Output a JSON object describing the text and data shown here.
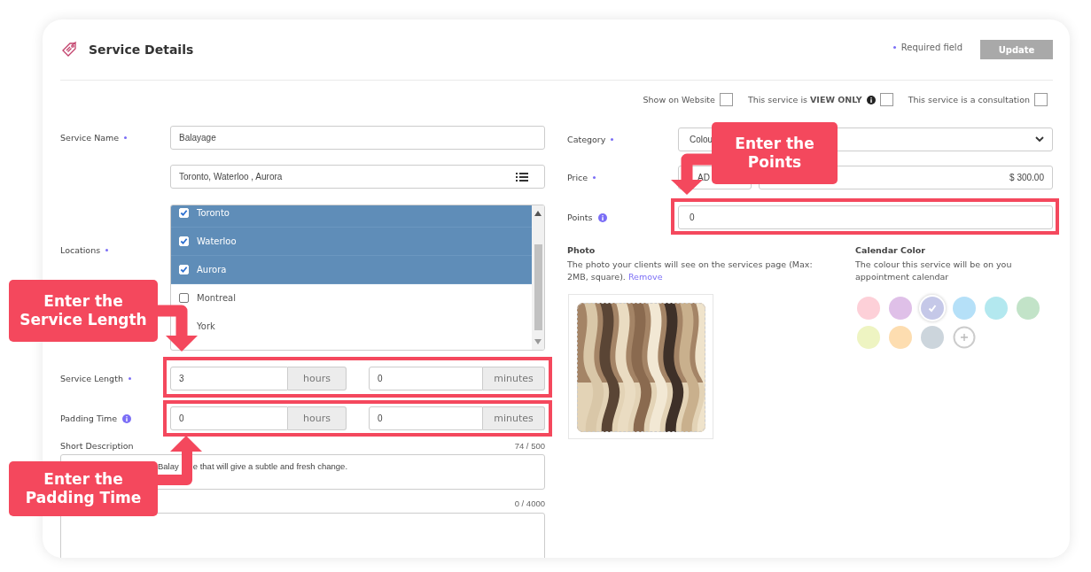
{
  "header": {
    "title": "Service Details",
    "required_note": "Required field",
    "update_button": {
      "label": "Update",
      "disabled": true
    }
  },
  "options": [
    {
      "label": "Show on Website",
      "checked": false
    },
    {
      "label": "This service is **VIEW ONLY**",
      "info": true,
      "checked": false
    },
    {
      "label": "This service is a consultation",
      "checked": false
    }
  ],
  "left": {
    "service_name": {
      "label": "Service Name",
      "required": true,
      "value": "Balayage"
    },
    "locations": {
      "label": "Locations",
      "required": true,
      "value": "Toronto, Waterloo , Aurora",
      "items": [
        {
          "label": "Toronto",
          "selected": true,
          "checked": true
        },
        {
          "label": "Waterloo",
          "selected": true,
          "checked": true
        },
        {
          "label": "Aurora",
          "selected": true,
          "checked": true
        },
        {
          "label": "Montreal",
          "selected": false,
          "checked": false
        },
        {
          "label": "York",
          "selected": false
        }
      ]
    },
    "service_length": {
      "label": "Service Length",
      "required": true,
      "hours": "3",
      "hours_unit": "hours",
      "minutes": "0",
      "minutes_unit": "minutes"
    },
    "padding_time": {
      "label": "Padding Time",
      "info": true,
      "hours": "0",
      "hours_unit": "hours",
      "minutes": "0",
      "minutes_unit": "minutes"
    },
    "short_description": {
      "label": "Short Description",
      "counter": "74 / 500",
      "value_parts": [
        "Balay",
        "e that will give a subtle and fresh change."
      ]
    },
    "long_description": {
      "counter": "0 / 4000"
    }
  },
  "right": {
    "category": {
      "label": "Category",
      "required": true,
      "value": "Colou"
    },
    "price": {
      "label": "Price",
      "required": true,
      "currency": "AD",
      "amount": "$ 300.00"
    },
    "points": {
      "label": "Points",
      "info": true,
      "value": "0"
    },
    "photo": {
      "label": "Photo",
      "description": "The photo your clients will see on the services page (Max: 2MB, square).",
      "link": "Remove"
    },
    "calendar_color": {
      "label": "Calendar Color",
      "description": "The colour this service will be on you appointment calendar",
      "swatches": [
        {
          "color": "#fdd0d8",
          "selected": false
        },
        {
          "color": "#dfc0e8",
          "selected": false
        },
        {
          "color": "#c5c8e8",
          "selected": true
        },
        {
          "color": "#b5e0f8",
          "selected": false
        },
        {
          "color": "#b3e8ef",
          "selected": false
        },
        {
          "color": "#c2e3c8",
          "selected": false
        },
        {
          "color": "#eef4c2",
          "selected": false
        },
        {
          "color": "#fdddb0",
          "selected": false
        },
        {
          "color": "#ccd5dc",
          "selected": false
        }
      ]
    }
  },
  "callouts": [
    {
      "kind": "service_length",
      "text": "Enter the\nService Length"
    },
    {
      "kind": "padding_time",
      "text": "Enter the\nPadding Time"
    },
    {
      "kind": "points",
      "text": "Enter the\nPoints"
    }
  ]
}
